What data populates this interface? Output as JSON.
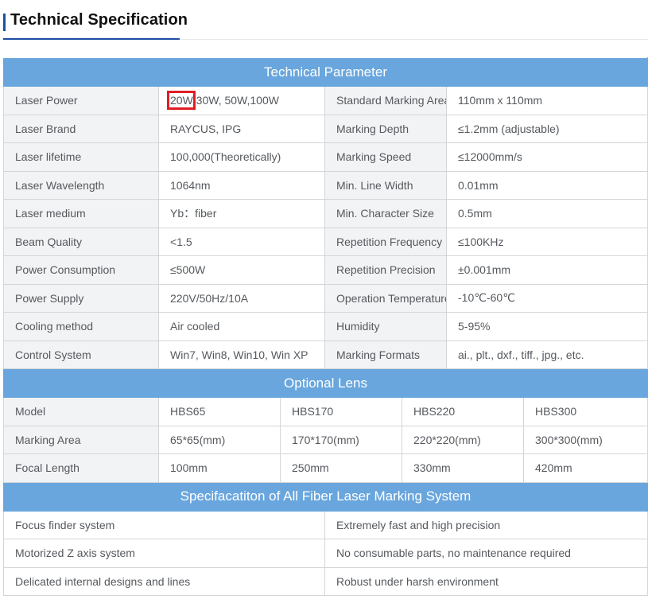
{
  "page_title": "Technical Specification",
  "technical_parameter": {
    "header": "Technical Parameter",
    "rows": [
      {
        "label1": "Laser Power",
        "value1_highlight": "20W",
        "value1_rest": " 30W, 50W,100W",
        "label2": "Standard Marking Area",
        "value2": "110mm x 110mm"
      },
      {
        "label1": "Laser Brand",
        "value1": "RAYCUS, IPG",
        "label2": "Marking Depth",
        "value2": "≤1.2mm (adjustable)"
      },
      {
        "label1": "Laser lifetime",
        "value1": "100,000(Theoretically)",
        "label2": "Marking Speed",
        "value2": "≤12000mm/s"
      },
      {
        "label1": "Laser Wavelength",
        "value1": "1064nm",
        "label2": "Min. Line Width",
        "value2": "0.01mm"
      },
      {
        "label1": "Laser medium",
        "value1": "Yb：fiber",
        "label2": "Min. Character Size",
        "value2": "0.5mm"
      },
      {
        "label1": "Beam Quality",
        "value1": "<1.5",
        "label2": "Repetition Frequency",
        "value2": "≤100KHz"
      },
      {
        "label1": "Power Consumption",
        "value1": "≤500W",
        "label2": "Repetition Precision",
        "value2": "±0.001mm"
      },
      {
        "label1": "Power Supply",
        "value1": "220V/50Hz/10A",
        "label2": "Operation Temperature",
        "value2": "-10℃-60℃"
      },
      {
        "label1": "Cooling method",
        "value1": "Air cooled",
        "label2": "Humidity",
        "value2": "5-95%"
      },
      {
        "label1": "Control System",
        "value1": "Win7, Win8, Win10, Win XP",
        "label2": "Marking Formats",
        "value2": "ai., plt., dxf., tiff., jpg., etc."
      }
    ]
  },
  "optional_lens": {
    "header": "Optional Lens",
    "rows": [
      {
        "label": "Model",
        "values": [
          "HBS65",
          "HBS170",
          "HBS220",
          "HBS300"
        ]
      },
      {
        "label": "Marking Area",
        "values": [
          "65*65(mm)",
          "170*170(mm)",
          "220*220(mm)",
          "300*300(mm)"
        ]
      },
      {
        "label": "Focal Length",
        "values": [
          "100mm",
          "250mm",
          "330mm",
          "420mm"
        ]
      }
    ]
  },
  "system_spec": {
    "header": "Specifacatiton of All Fiber Laser Marking System",
    "rows": [
      {
        "left": "Focus finder system",
        "right": "Extremely fast and high precision"
      },
      {
        "left": "Motorized Z axis system",
        "right": "No consumable parts, no maintenance required"
      },
      {
        "left": "Delicated internal designs and lines",
        "right": "Robust under harsh environment"
      }
    ]
  },
  "colors": {
    "band": "#69a6dd",
    "heading_accent": "#1d4fa3",
    "highlight_box": "#e01e24",
    "label_bg": "#f2f3f4"
  }
}
